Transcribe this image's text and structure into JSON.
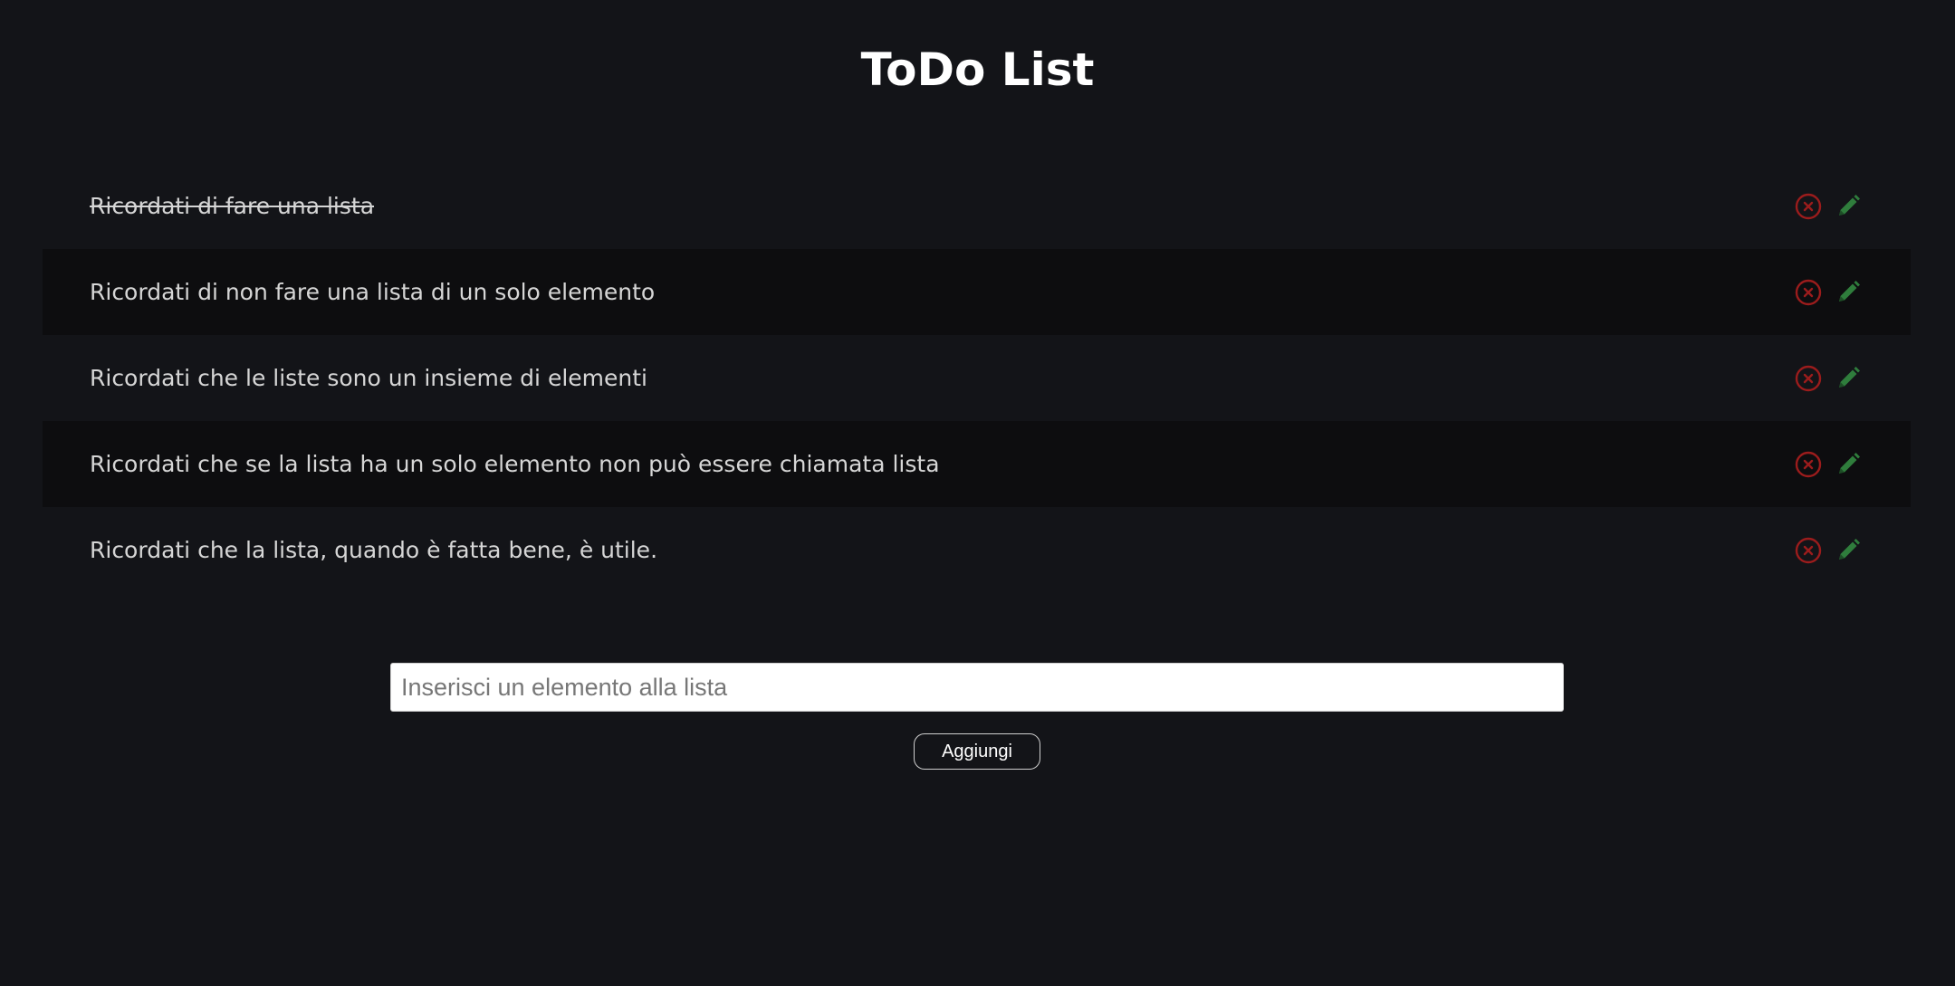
{
  "header": {
    "title": "ToDo List"
  },
  "todos": [
    {
      "text": "Ricordati di fare una lista",
      "done": true
    },
    {
      "text": "Ricordati di non fare una lista di un solo elemento",
      "done": false
    },
    {
      "text": "Ricordati che le liste sono un insieme di elementi",
      "done": false
    },
    {
      "text": "Ricordati che se la lista ha un solo elemento non può essere chiamata lista",
      "done": false
    },
    {
      "text": "Ricordati che la lista, quando è fatta bene, è utile.",
      "done": false
    }
  ],
  "icons": {
    "delete": "circle-x-icon",
    "edit": "pencil-icon"
  },
  "colors": {
    "background": "#131418",
    "row_alt": "#0d0d0f",
    "delete": "#9b1c1c",
    "edit": "#2f7d3c"
  },
  "form": {
    "input_placeholder": "Inserisci un elemento alla lista",
    "input_value": "",
    "add_label": "Aggiungi"
  }
}
